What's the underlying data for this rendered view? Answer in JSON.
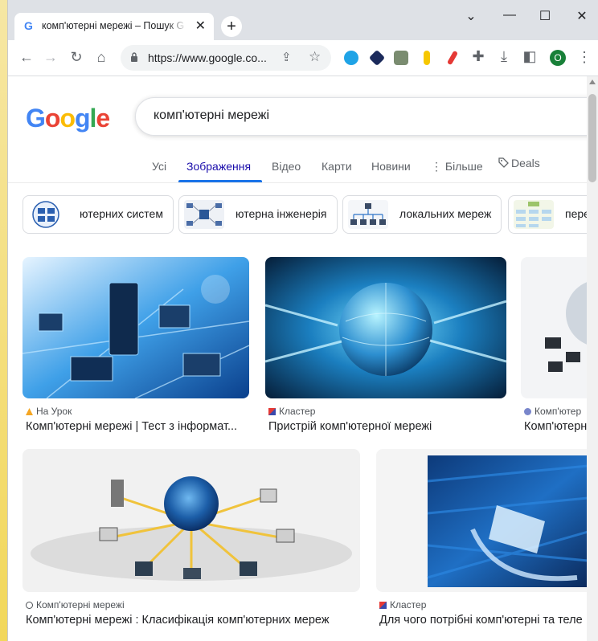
{
  "browser": {
    "tab_title": "комп'ютерні мережі – Пошук G",
    "tab_close": "✕",
    "new_tab": "+",
    "win_chevron": "⌄",
    "win_minimize": "—",
    "win_maximize": "☐",
    "win_close": "✕",
    "url": "https://www.google.co...",
    "profile_initial": "O"
  },
  "google": {
    "logo": [
      "G",
      "o",
      "o",
      "g",
      "l",
      "e"
    ],
    "logo_colors": [
      "#4285f4",
      "#ea4335",
      "#fbbc05",
      "#4285f4",
      "#34a853",
      "#ea4335"
    ],
    "query": "комп'ютерні мережі"
  },
  "nav_tabs": [
    "Усі",
    "Зображення",
    "Відео",
    "Карти",
    "Новини",
    "⋮ Більше",
    "Deals"
  ],
  "active_tab": "Зображення",
  "chips": [
    {
      "label": "ютерних систем"
    },
    {
      "label": "ютерна інженерія"
    },
    {
      "label": "локальних мереж"
    },
    {
      "label": "перед"
    }
  ],
  "results": [
    {
      "source": "На Урок",
      "title": "Комп'ютерні мережі | Тест з інформат..."
    },
    {
      "source": "Кластер",
      "title": "Пристрій комп'ютерної мережі"
    },
    {
      "source": "Комп'ютер",
      "title": "Комп'ютерн"
    },
    {
      "source": "Комп'ютерні мережі",
      "title": "Комп'ютерні мережі : Класифікація комп'ютерних мереж"
    },
    {
      "source": "Кластер",
      "title": "Для чого потрібні комп'ютерні та теле"
    }
  ]
}
